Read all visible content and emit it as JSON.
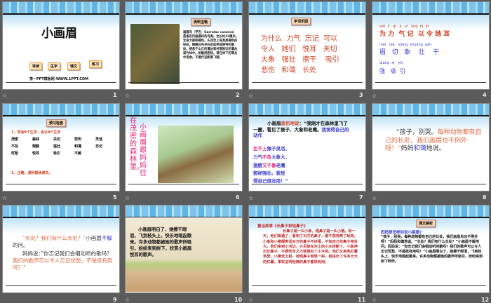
{
  "slides": [
    {
      "number": "1",
      "title": "小画眉",
      "buttons": [
        "导读",
        "生字",
        "课文",
        "练习"
      ],
      "site": "第一PPT模板网-WWW.1PPT.COM"
    },
    {
      "number": "2",
      "tag": "资料宝箱",
      "text": "画眉鸟（学名：Garrulax canorus）是雀形目画眉科的鸟类。全长约23厘米。全身大部棕褐色。头顶至上背具黑褐色的纵纹。眼圈白色并向后延伸成狭窄的眉纹。栖息于山丘的灌丛和村落附近的灌丛或竹林中。机敏而胆怯。常在林下的草丛中觅食。不善作远距离飞翔。"
    },
    {
      "number": "3",
      "tag": "字词乐园",
      "lines": [
        "为什么  力气  忘记  可以",
        "令人   她们   悦耳   关切",
        "大象   强壮   擦干    吸引",
        "悲伤   和蔼   长处"
      ]
    },
    {
      "number": "4",
      "rows": [
        {
          "py": "wèi  lì   qì   jì   yǐ   lìng  tā  ěr",
          "hz": "为 力  气 记  以 令 她 耳"
        },
        {
          "py": "méi   qiè   xiàng  zhuàng  gān",
          "hz": "眉   切   象    壮    干"
        },
        {
          "py": "qiáng  xī   yǐn",
          "hz": "强   吸  引"
        }
      ]
    },
    {
      "number": "5",
      "tag": "预习检查",
      "q1": "1、学会8个生字，会认9个生字",
      "words": [
        "茂密",
        "森林",
        "关切",
        "悲伤",
        "灵活",
        "不及",
        "翅膀",
        "强壮",
        "和蔼",
        "忘记",
        "忧愁",
        "悦耳",
        "吸引",
        "不解"
      ],
      "q2": "2、正确、流利朗读课文。"
    },
    {
      "number": "6",
      "col1": "在茂密的森林里。",
      "col2": "小画眉跟妈妈住"
    },
    {
      "number": "7",
      "p1a": "小画眉",
      "p1b": "悲伤地说",
      "p1c": "：“我刚才在森林里飞了一圈，看见了猴子、大象和老鹰。",
      "p1d": "我觉得自己的动作",
      "l1a": "比不上",
      "l1b": "猴子灵活，",
      "l2a": "力气",
      "l2b": "不及",
      "l2c": "大象大，",
      "l3a": "翅膀",
      "l3b": "又不像",
      "l3c": "老鹰",
      "l4": "那样强壮。我觉",
      "l5": "得自己很没用！”"
    },
    {
      "number": "8",
      "a": "“孩子，别哭。",
      "b": "每种动物都有自己的长处，我们画眉也不例外呀！”",
      "c": "妈妈",
      "d": "和蔼",
      "e": "地说。"
    },
    {
      "number": "9",
      "a": "“长处？我们有什么长处？”",
      "b": "小画眉",
      "c": "不解",
      "d": "的问。",
      "e": "妈妈说：”你忘记我们会唱动听的歌吗？",
      "f": "我们的歌声可以令人忘记忧愁，不是挺有用吗？”"
    },
    {
      "number": "10",
      "text": "小画眉明白了，她擦干眼泪，飞到枝头上，快乐地唱起歌来。许多动物都被她的歌声所吸引，纷纷来到树下，欣赏小画眉悦耳的歌声。"
    },
    {
      "number": "11",
      "title": "童话故事《长鼻子和短鼻子》",
      "text": "长鼻子是一头小象，短鼻子是一头小猪。有一天，他们相遇了，看到了对方的鼻子，都不禁地笑了起来。小象和小猪都笑话对方的鼻子不好看，不如自己的鼻子用处大。他们来到小河边，只见架在河上的小木桥断了。小象伸出长鼻子，不费吹灰之力就搭好了小木桥。他们又来到红薯地里，小猪走上前，用短鼻子轻轻一拱，就拱出了许多大大的红薯。事实证明他俩的鼻子都很有用。"
    },
    {
      "number": "12",
      "tag": "课文解析",
      "q": "妈妈是怎样劝说小画眉?",
      "text": "“孩子，别哭。每种动物都有自己的长处，我们画眉鸟也不例外呀！”妈妈和蔼地说。“长处？我们有什么长处？”小画眉不解地问。妈妈说：“你忘记我们会唱动听的歌吗？我们的歌声可以令人忘记忧愁，不是挺有用吗？”小画眉明白了，她擦干眼泪，飞到枝头上，快乐地唱起歌来。许多动物都被她的歌声所吸引，纷纷来到树下聆听。"
    }
  ],
  "star_icon": "☆"
}
